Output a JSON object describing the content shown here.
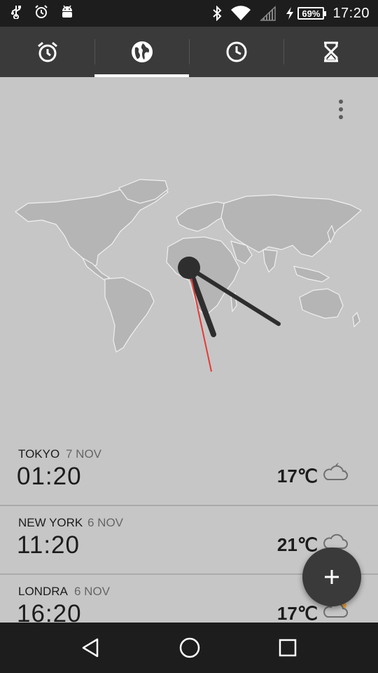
{
  "status_bar": {
    "icons": [
      "usb-icon",
      "alarm-icon",
      "android-icon",
      "bluetooth-icon",
      "wifi-icon",
      "signal-icon",
      "charging-icon"
    ],
    "battery": "69%",
    "time": "17:20"
  },
  "tabs": [
    {
      "icon": "alarm-clock-icon",
      "active": false
    },
    {
      "icon": "globe-icon",
      "active": true
    },
    {
      "icon": "clock-icon",
      "active": false
    },
    {
      "icon": "hourglass-icon",
      "active": false
    }
  ],
  "cities": [
    {
      "name": "TOKYO",
      "date": "7 NOV",
      "time": "01:20",
      "temp": "17℃",
      "weather": "partly-cloudy-night-icon"
    },
    {
      "name": "NEW YORK",
      "date": "6 NOV",
      "time": "11:20",
      "temp": "21℃",
      "weather": "cloud-icon"
    },
    {
      "name": "LONDRA",
      "date": "6 NOV",
      "time": "16:20",
      "temp": "17℃",
      "weather": "partly-cloudy-day-icon"
    }
  ],
  "colors": {
    "background": "#c6c6c6",
    "tabbar": "#3a3a3a",
    "status_bar": "#1d1d1d",
    "clock_hand": "#2e2e2e",
    "second_hand": "#e53935"
  }
}
